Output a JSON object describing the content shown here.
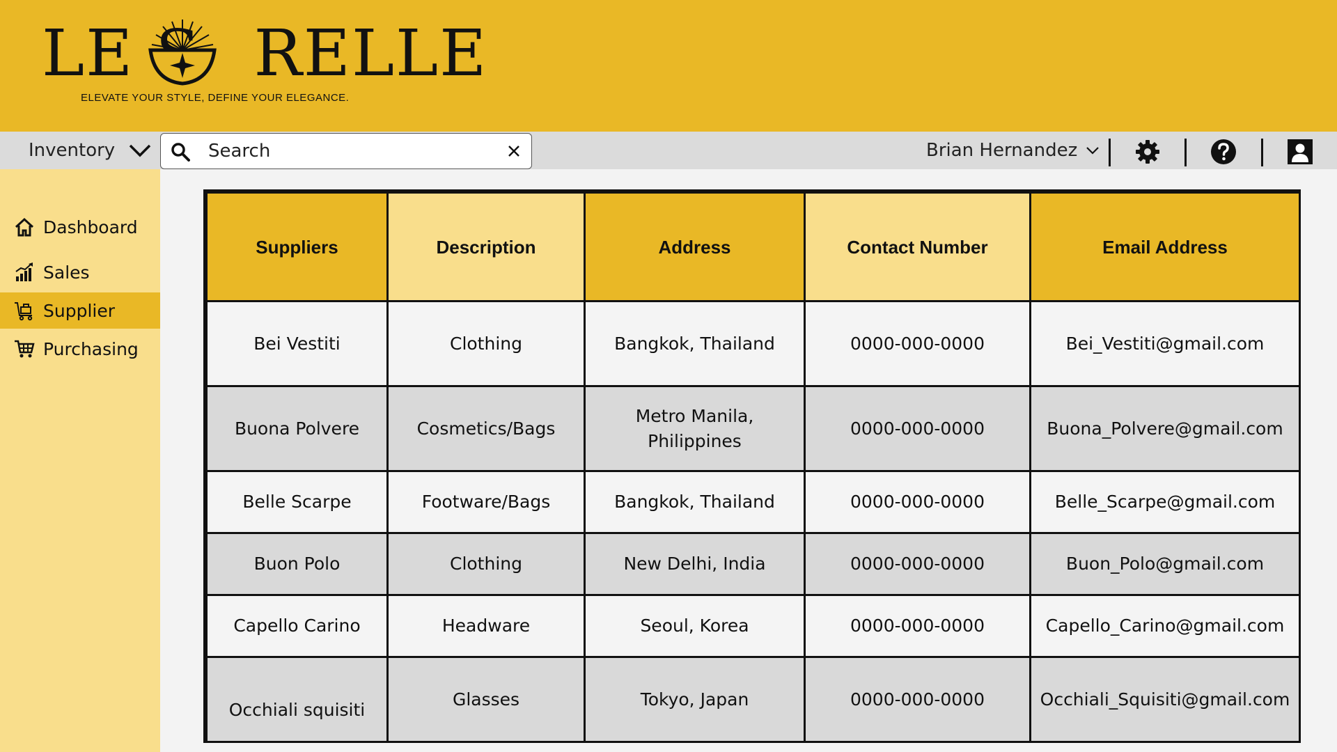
{
  "brand": {
    "logo_text": "LE SORELLE",
    "tagline": "ELEVATE YOUR STYLE, DEFINE YOUR ELEGANCE."
  },
  "toolbar": {
    "module_label": "Inventory",
    "search_placeholder": "Search",
    "user_name": "Brian Hernandez",
    "icons": [
      "gear-icon",
      "help-icon",
      "user-profile-icon"
    ]
  },
  "sidebar": {
    "items": [
      {
        "label": "Dashboard",
        "icon": "home-icon",
        "active": false
      },
      {
        "label": "Sales",
        "icon": "bar-chart-icon",
        "active": false
      },
      {
        "label": "Supplier",
        "icon": "delivery-cart-icon",
        "active": true
      },
      {
        "label": "Purchasing",
        "icon": "shopping-cart-icon",
        "active": false
      }
    ]
  },
  "table": {
    "headers": [
      "Suppliers",
      "Description",
      "Address",
      "Contact Number",
      "Email Address"
    ],
    "rows": [
      [
        "Bei Vestiti",
        "Clothing",
        "Bangkok, Thailand",
        "0000-000-0000",
        "Bei_Vestiti@gmail.com"
      ],
      [
        "Buona Polvere",
        "Cosmetics/Bags",
        "Metro Manila, Philippines",
        "0000-000-0000",
        "Buona_Polvere@gmail.com"
      ],
      [
        "Belle Scarpe",
        "Footware/Bags",
        "Bangkok, Thailand",
        "0000-000-0000",
        "Belle_Scarpe@gmail.com"
      ],
      [
        "Buon Polo",
        "Clothing",
        "New Delhi, India",
        "0000-000-0000",
        "Buon_Polo@gmail.com"
      ],
      [
        "Capello Carino",
        "Headware",
        "Seoul, Korea",
        "0000-000-0000",
        "Capello_Carino@gmail.com"
      ],
      [
        "Occhiali squisiti",
        "Glasses",
        "Tokyo, Japan",
        "0000-000-0000",
        "Occhiali_Squisiti@gmail.com"
      ]
    ]
  },
  "colors": {
    "brand_gold": "#e9b826",
    "light_gold": "#f9de8c",
    "toolbar_gray": "#dbdbdb",
    "row_light": "#f4f4f4",
    "row_dark": "#d9d9d9"
  }
}
